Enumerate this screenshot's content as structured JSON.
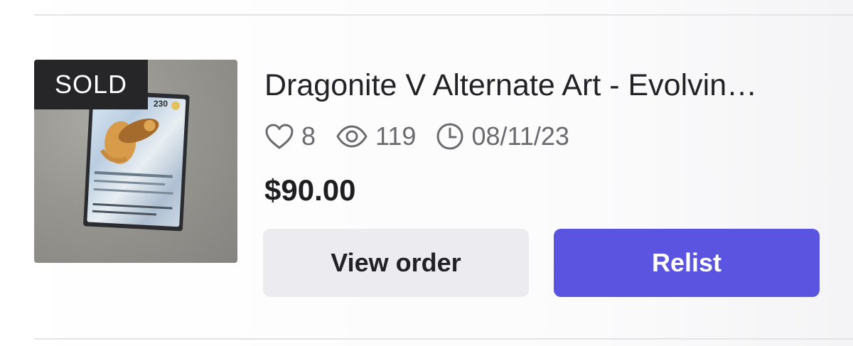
{
  "listing": {
    "badge": "SOLD",
    "title": "Dragonite V Alternate Art - Evolvin…",
    "stats": {
      "likes": "8",
      "views": "119",
      "date": "08/11/23"
    },
    "price": "$90.00",
    "image_alt_text": "Dragonite V trading card photo",
    "card_hp_text": "230"
  },
  "actions": {
    "view_order_label": "View order",
    "relist_label": "Relist"
  },
  "icons": {
    "likes": "heart-icon",
    "views": "eye-icon",
    "date": "clock-icon"
  },
  "colors": {
    "accent": "#5a54e0",
    "secondary_button": "#ececf0",
    "badge_bg": "#262628",
    "muted_text": "#6a6a70"
  }
}
